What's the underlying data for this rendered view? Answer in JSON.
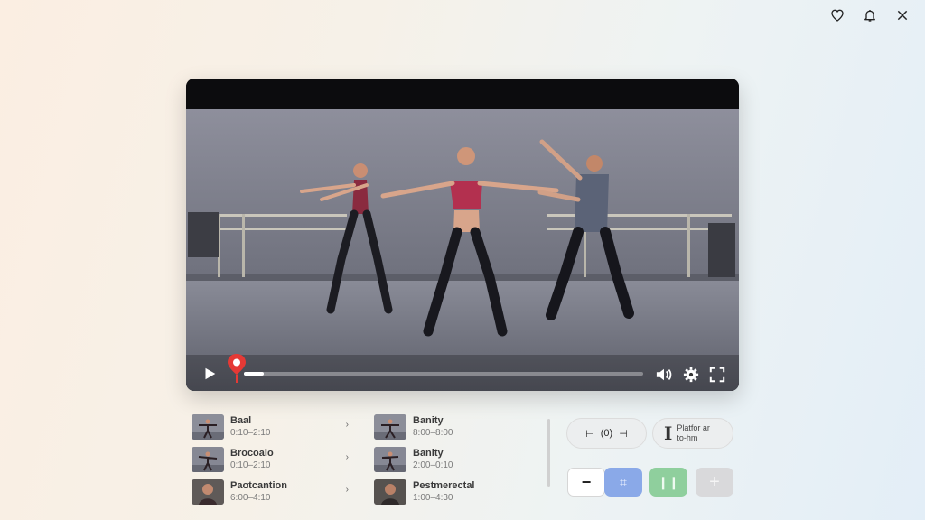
{
  "top_actions": {
    "icons": [
      "heart-icon",
      "bell-icon",
      "close-icon"
    ]
  },
  "player": {
    "scene": "dance-rehearsal-video-frame",
    "progress": 0.05,
    "accent_color": "#e53935"
  },
  "playlist_left": [
    {
      "title": "Baal",
      "subtitle": "0:10–2:10"
    },
    {
      "title": "Brocoalo",
      "subtitle": "0:10–2:10"
    },
    {
      "title": "Paotcantion",
      "subtitle": "6:00–4:10"
    }
  ],
  "playlist_right": [
    {
      "title": "Banity",
      "subtitle": "8:00–8:00"
    },
    {
      "title": "Banity",
      "subtitle": "2:00–0:10"
    },
    {
      "title": "Pestmerectal",
      "subtitle": "1:00–4:30"
    }
  ],
  "side_tools": {
    "pill_a_label": "(0)",
    "pill_b_line1": "Platfor ar",
    "pill_b_line2": "to-hm"
  },
  "colors": {
    "crop_button": "#8aa9e8",
    "pause_button": "#8fcf9d",
    "plus_button": "#d9d9db"
  }
}
